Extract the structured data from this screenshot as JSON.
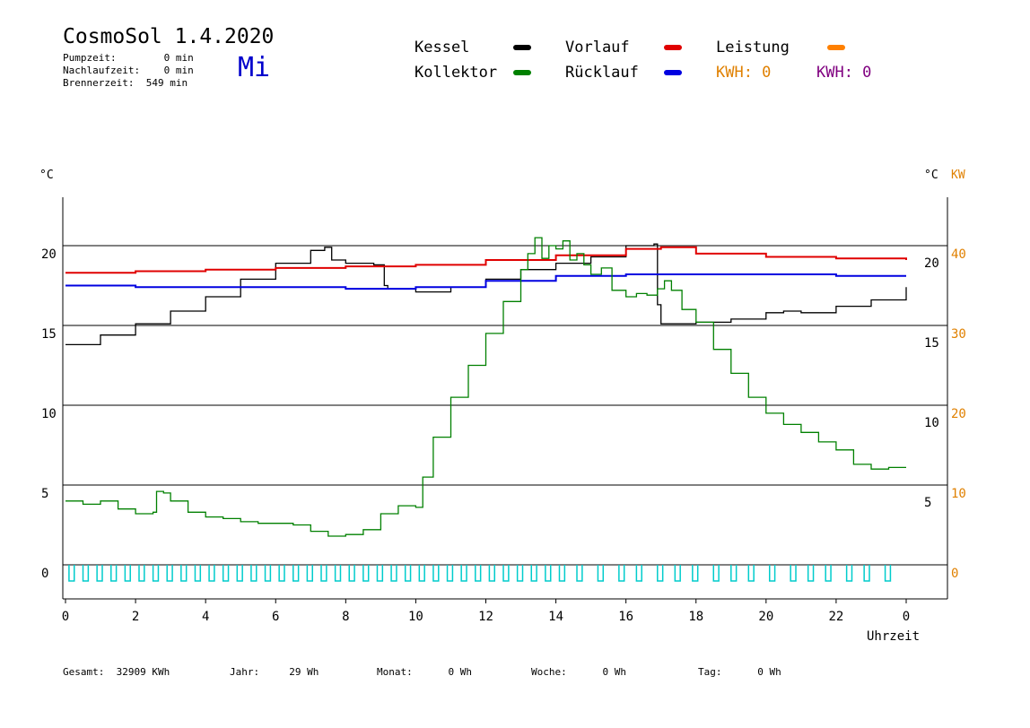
{
  "header": {
    "title": "CosmoSol 1.4.2020",
    "pumpzeit": "Pumpzeit:        0 min",
    "nachlaufzeit": "Nachlaufzeit:    0 min",
    "brennerzeit": "Brennerzeit:  549 min",
    "weekday": "Mi"
  },
  "legend": {
    "kessel": {
      "label": "Kessel",
      "color": "#000000"
    },
    "vorlauf": {
      "label": "Vorlauf",
      "color": "#e00000"
    },
    "leistung": {
      "label": "Leistung",
      "color": "#ff8000"
    },
    "kollektor": {
      "label": "Kollektor",
      "color": "#008000"
    },
    "ruecklauf": {
      "label": "Rücklauf",
      "color": "#0000e0"
    },
    "kwh1": {
      "label": "KWH: 0",
      "color": "#e08000"
    },
    "kwh2": {
      "label": "KWH: 0",
      "color": "#800080"
    }
  },
  "axes": {
    "left_unit": "°C",
    "right_unit": "°C",
    "right_unit2": "KW",
    "xlabel": "Uhrzeit"
  },
  "footer": {
    "gesamt": "Gesamt:  32909 KWh",
    "jahr": "Jahr:     29 Wh",
    "monat": "Monat:      0 Wh",
    "woche": "Woche:      0 Wh",
    "tag": "Tag:      0 Wh"
  },
  "chart_data": {
    "type": "line",
    "x_ticks": [
      "0",
      "2",
      "4",
      "6",
      "8",
      "10",
      "12",
      "14",
      "16",
      "18",
      "20",
      "22",
      "0"
    ],
    "xlim": [
      0,
      24
    ],
    "y_left_ticks": [
      0,
      5,
      10,
      15,
      20
    ],
    "y_right_ticks": [
      5,
      10,
      15,
      20
    ],
    "y_right2_ticks": [
      0,
      10,
      20,
      30,
      40
    ],
    "ylim": [
      -2,
      23
    ],
    "grid": "horizontal",
    "series": [
      {
        "name": "Kessel",
        "color": "#000000",
        "x": [
          0,
          1,
          2,
          3,
          4,
          5,
          6,
          7,
          7.4,
          7.6,
          8,
          8.8,
          9.1,
          9.2,
          9.5,
          10,
          11,
          12,
          13,
          14,
          15,
          16,
          16.8,
          16.9,
          17,
          18,
          19,
          20,
          20.5,
          21,
          22,
          23,
          24
        ],
        "y": [
          13.8,
          14.4,
          15.1,
          15.9,
          16.8,
          17.9,
          18.9,
          19.7,
          19.9,
          19.1,
          18.9,
          18.8,
          17.5,
          17.3,
          17.3,
          17.1,
          17.4,
          17.9,
          18.5,
          18.9,
          19.3,
          20.0,
          20.1,
          16.3,
          15.1,
          15.2,
          15.4,
          15.8,
          15.9,
          15.8,
          16.2,
          16.6,
          17.4
        ]
      },
      {
        "name": "Vorlauf",
        "color": "#e00000",
        "x": [
          0,
          2,
          4,
          6,
          8,
          10,
          12,
          14,
          16,
          17,
          18,
          20,
          22,
          24
        ],
        "y": [
          18.3,
          18.4,
          18.5,
          18.6,
          18.7,
          18.8,
          19.1,
          19.4,
          19.8,
          19.9,
          19.5,
          19.3,
          19.2,
          19.1
        ]
      },
      {
        "name": "Rücklauf",
        "color": "#0000e0",
        "x": [
          0,
          2,
          4,
          6,
          8,
          10,
          12,
          14,
          16,
          18,
          20,
          22,
          24
        ],
        "y": [
          17.5,
          17.4,
          17.4,
          17.4,
          17.3,
          17.4,
          17.8,
          18.1,
          18.2,
          18.2,
          18.2,
          18.1,
          18.1
        ]
      },
      {
        "name": "Kollektor",
        "color": "#008000",
        "x": [
          0,
          0.5,
          1,
          1.5,
          2,
          2.5,
          2.6,
          2.8,
          3,
          3.5,
          4,
          4.5,
          5,
          5.5,
          6,
          6.5,
          7,
          7.5,
          8,
          8.5,
          9,
          9.5,
          10,
          10.2,
          10.5,
          11,
          11.5,
          12,
          12.5,
          13,
          13.2,
          13.4,
          13.6,
          13.8,
          14,
          14.2,
          14.4,
          14.6,
          14.8,
          15,
          15.3,
          15.6,
          16,
          16.3,
          16.6,
          16.9,
          17.1,
          17.3,
          17.6,
          18,
          18.5,
          19,
          19.5,
          20,
          20.5,
          21,
          21.5,
          22,
          22.5,
          23,
          23.5,
          24
        ],
        "y": [
          4.0,
          3.8,
          4.0,
          3.5,
          3.2,
          3.3,
          4.6,
          4.5,
          4.0,
          3.3,
          3.0,
          2.9,
          2.7,
          2.6,
          2.6,
          2.5,
          2.1,
          1.8,
          1.9,
          2.2,
          3.2,
          3.7,
          3.6,
          5.5,
          8.0,
          10.5,
          12.5,
          14.5,
          16.5,
          18.5,
          19.5,
          20.5,
          19.2,
          20.0,
          19.8,
          20.3,
          19.1,
          19.5,
          18.8,
          18.2,
          18.6,
          17.2,
          16.8,
          17.0,
          16.9,
          17.3,
          17.8,
          17.2,
          16.0,
          15.2,
          13.5,
          12.0,
          10.5,
          9.5,
          8.8,
          8.3,
          7.7,
          7.2,
          6.3,
          6.0,
          6.1,
          6.1
        ]
      }
    ],
    "burner_pulses": {
      "name": "Brenner",
      "color": "#00cccc",
      "x": [
        0.1,
        0.5,
        0.9,
        1.3,
        1.7,
        2.1,
        2.5,
        2.9,
        3.3,
        3.7,
        4.1,
        4.5,
        4.9,
        5.3,
        5.7,
        6.1,
        6.5,
        6.9,
        7.3,
        7.7,
        8.1,
        8.5,
        8.9,
        9.3,
        9.7,
        10.1,
        10.5,
        10.9,
        11.3,
        11.7,
        12.1,
        12.5,
        12.9,
        13.3,
        13.7,
        14.1,
        14.6,
        15.2,
        15.8,
        16.3,
        16.9,
        17.4,
        17.9,
        18.5,
        19.0,
        19.5,
        20.1,
        20.7,
        21.2,
        21.7,
        22.3,
        22.8,
        23.4
      ],
      "duration_h": 0.15,
      "level": 0
    }
  }
}
